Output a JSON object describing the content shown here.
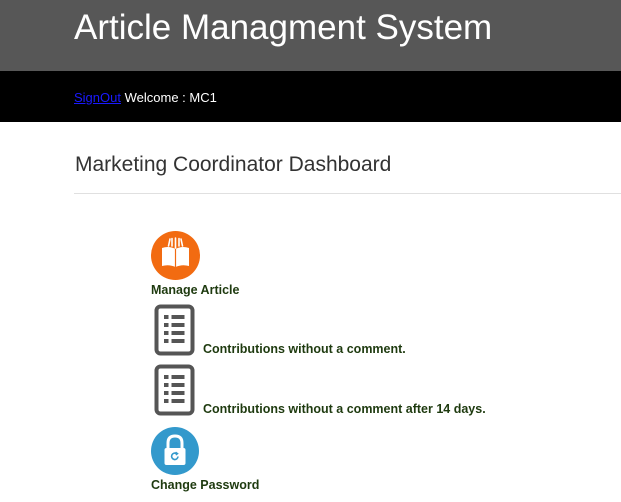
{
  "header": {
    "title": "Article Managment System",
    "signout_label": "SignOut",
    "welcome_text": "Welcome : MC1",
    "top_color": "#575757",
    "bar_color": "#000000"
  },
  "main": {
    "page_title": "Marketing Coordinator Dashboard",
    "items": [
      {
        "label": "Manage Article",
        "icon": "book-icon",
        "icon_color": "#f26b11"
      },
      {
        "label": "Contributions without a comment.",
        "icon": "document-list-icon",
        "icon_color": "#555555"
      },
      {
        "label": "Contributions without a comment after 14 days.",
        "icon": "document-list-icon",
        "icon_color": "#555555"
      },
      {
        "label": "Change Password",
        "icon": "padlock-icon",
        "icon_color": "#3399cc"
      }
    ]
  }
}
